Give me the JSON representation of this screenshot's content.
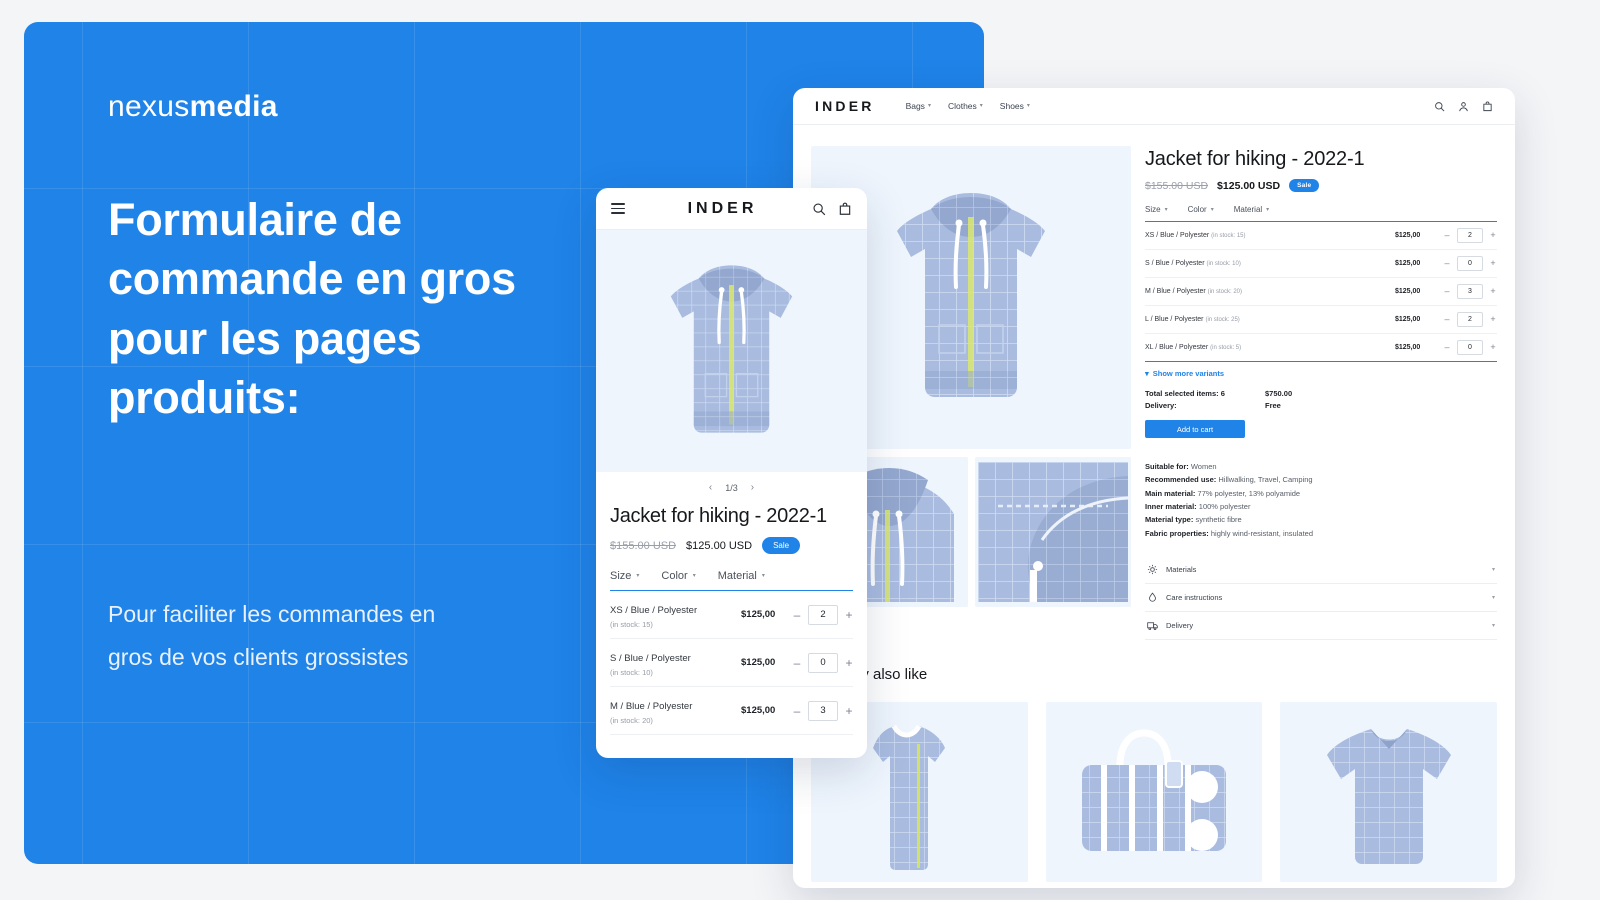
{
  "promo": {
    "brand_light": "nexus",
    "brand_bold": "media",
    "title": "Formulaire de commande en gros pour les pages produits:",
    "subtitle": "Pour faciliter les commandes en gros de vos clients grossistes",
    "bg_color": "#1f83e8"
  },
  "desktop": {
    "logo": "INDER",
    "nav": [
      {
        "label": "Bags"
      },
      {
        "label": "Clothes"
      },
      {
        "label": "Shoes"
      }
    ],
    "icons": [
      "search-icon",
      "account-icon",
      "cart-icon"
    ],
    "product": {
      "title": "Jacket for hiking - 2022-1",
      "price_old": "$155.00 USD",
      "price_new": "$125.00 USD",
      "sale_badge": "Sale"
    },
    "filters": [
      {
        "label": "Size"
      },
      {
        "label": "Color"
      },
      {
        "label": "Material"
      }
    ],
    "variants": [
      {
        "name": "XS / Blue / Polyester",
        "stock": "(in stock: 15)",
        "price": "$125,00",
        "qty": "2"
      },
      {
        "name": "S / Blue / Polyester",
        "stock": "(in stock: 10)",
        "price": "$125,00",
        "qty": "0"
      },
      {
        "name": "M / Blue / Polyester",
        "stock": "(in stock: 20)",
        "price": "$125,00",
        "qty": "3"
      },
      {
        "name": "L / Blue / Polyester",
        "stock": "(in stock: 25)",
        "price": "$125,00",
        "qty": "2"
      },
      {
        "name": "XL / Blue / Polyester",
        "stock": "(in stock: 5)",
        "price": "$125,00",
        "qty": "0"
      }
    ],
    "show_more": "Show  more variants",
    "totals": {
      "items_label": "Total selected items: 6",
      "items_value": "$750.00",
      "delivery_label": "Delivery:",
      "delivery_value": "Free"
    },
    "add_to_cart": "Add to cart",
    "specs": [
      {
        "key": "Suitable for:",
        "value": "Women"
      },
      {
        "key": "Recommended use:",
        "value": "Hillwalking, Travel, Camping"
      },
      {
        "key": "Main material:",
        "value": "77% polyester, 13% polyamide"
      },
      {
        "key": "Inner material:",
        "value": "100% polyester"
      },
      {
        "key": "Material type:",
        "value": "synthetic fibre"
      },
      {
        "key": "Fabric properties:",
        "value": "highly wind-resistant, insulated"
      }
    ],
    "accordion": [
      {
        "label": "Materials",
        "icon": "materials-icon"
      },
      {
        "label": "Care instructions",
        "icon": "care-icon"
      },
      {
        "label": "Delivery",
        "icon": "delivery-icon"
      }
    ],
    "also_like_title": "You may also like",
    "also_like": [
      {
        "name": "tank-top"
      },
      {
        "name": "handbag"
      },
      {
        "name": "t-shirt"
      }
    ],
    "accent_color": "#1f83e8"
  },
  "mobile": {
    "logo": "INDER",
    "pager": "1/3",
    "pager_prev": "‹",
    "pager_next": "›",
    "product": {
      "title": "Jacket for hiking - 2022-1",
      "price_old": "$155.00 USD",
      "price_new": "$125.00 USD",
      "sale_badge": "Sale"
    },
    "filters": [
      {
        "label": "Size"
      },
      {
        "label": "Color"
      },
      {
        "label": "Material"
      }
    ],
    "variants": [
      {
        "name": "XS / Blue / Polyester",
        "stock": "(in stock: 15)",
        "price": "$125,00",
        "qty": "2"
      },
      {
        "name": "S / Blue / Polyester",
        "stock": "(in stock: 10)",
        "price": "$125,00",
        "qty": "0"
      },
      {
        "name": "M / Blue / Polyester",
        "stock": "(in stock: 20)",
        "price": "$125,00",
        "qty": "3"
      }
    ],
    "minus": "–",
    "plus": "+"
  },
  "symbols": {
    "minus": "–",
    "plus": "+",
    "caret": "⌄",
    "chevron": "⌄",
    "tri": "▾"
  }
}
